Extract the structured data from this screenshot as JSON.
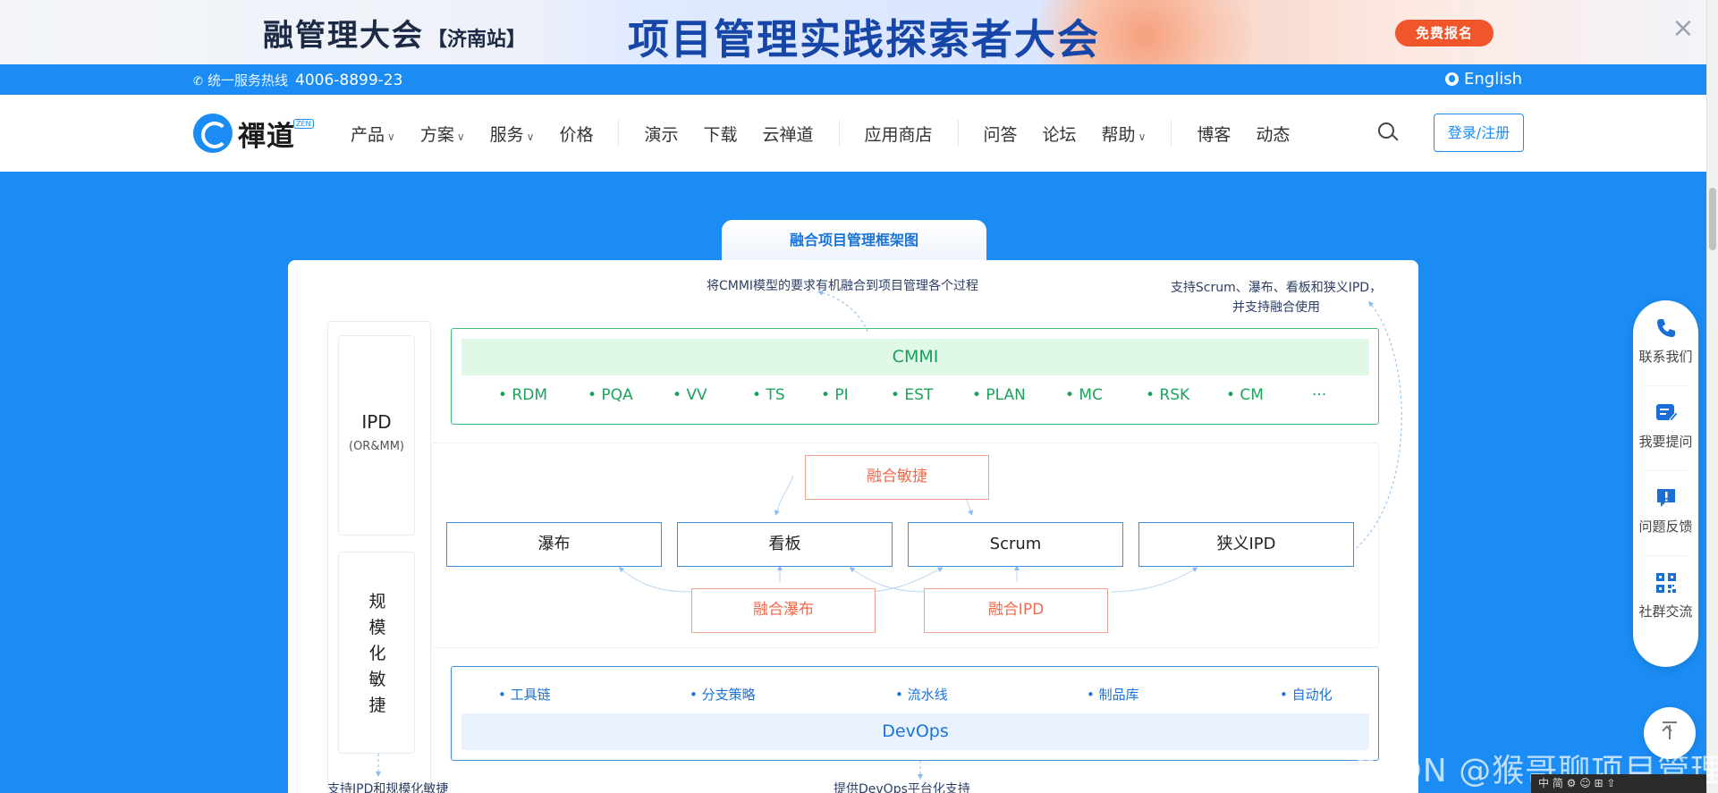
{
  "banner": {
    "title_left": "融管理大会",
    "station": "【济南站】",
    "title_main": "项目管理实践探索者大会",
    "signup_label": "免费报名",
    "close_glyph": "×"
  },
  "topbar": {
    "hotline_label": "统一服务热线",
    "hotline_number": "4006-8899-23",
    "language": "English"
  },
  "nav": {
    "logo_text": "禪道",
    "logo_badge": "ZEN",
    "items": [
      "产品",
      "方案",
      "服务",
      "价格",
      "演示",
      "下载",
      "云禅道",
      "应用商店",
      "问答",
      "论坛",
      "帮助",
      "博客",
      "动态"
    ],
    "login_label": "登录/注册"
  },
  "diagram": {
    "tab_title": "融合项目管理框架图",
    "note_cmmi": "将CMMI模型的要求有机融合到项目管理各个过程",
    "note_support_line1": "支持Scrum、瀑布、看板和狭义IPD，",
    "note_support_line2": "并支持融合使用",
    "ipd_title": "IPD",
    "ipd_sub": "(OR&MM)",
    "agile_chars": [
      "规",
      "模",
      "化",
      "敏",
      "捷"
    ],
    "cmmi_title": "CMMI",
    "cmmi_items": [
      "• RDM",
      "• PQA",
      "• VV",
      "• TS",
      "• PI",
      "• EST",
      "• PLAN",
      "• MC",
      "• RSK",
      "• CM",
      "···"
    ],
    "fusion_agile": "融合敏捷",
    "methods": [
      "瀑布",
      "看板",
      "Scrum",
      "狭义IPD"
    ],
    "fusion_waterfall": "融合瀑布",
    "fusion_ipd": "融合IPD",
    "devops_items": [
      "• 工具链",
      "• 分支策略",
      "• 流水线",
      "• 制品库",
      "• 自动化"
    ],
    "devops_title": "DevOps",
    "bottom_note_left": "支持IPD和规模化敏捷",
    "bottom_note_mid": "提供DevOps平台化支持"
  },
  "side_widget": {
    "items": [
      {
        "label": "联系我们",
        "icon": "phone-icon"
      },
      {
        "label": "我要提问",
        "icon": "question-icon"
      },
      {
        "label": "问题反馈",
        "icon": "feedback-icon"
      },
      {
        "label": "社群交流",
        "icon": "qrcode-icon"
      }
    ]
  },
  "watermark": "CSDN @猴哥聊项目管理",
  "ime_bar": "中 简 ⚙ ☺ ⊞ ⇧"
}
